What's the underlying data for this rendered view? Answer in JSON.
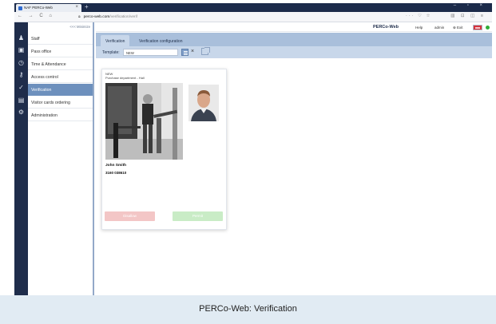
{
  "browser": {
    "tab_title": "NAF PERCo-Web",
    "tab_close": "×",
    "new_tab": "+",
    "window_controls": "– ▫ ×",
    "nav_buttons": "← → C ⌂",
    "url_host": "perco-web.com",
    "url_path": "/verification/verif",
    "url_icons": "··· ♡ ☆",
    "ext_icons": "▥ ⊡ ◫ ≡"
  },
  "sidebar_icons": [
    "person-icon",
    "box-icon",
    "clock-icon",
    "key-icon",
    "check-person-icon",
    "card-icon",
    "gear-icon"
  ],
  "menu": {
    "minimize": "<<< Minimize",
    "items": [
      {
        "label": "Staff"
      },
      {
        "label": "Pass office"
      },
      {
        "label": "Time & Attendance"
      },
      {
        "label": "Access control"
      },
      {
        "label": "Verification"
      },
      {
        "label": "Visitor cards ordering"
      },
      {
        "label": "Administration"
      }
    ],
    "active_index": 4
  },
  "topbar": {
    "brand": "PERCo-Web",
    "help": "Help",
    "user": "admin",
    "exit": "⊗ Exit"
  },
  "tabs": [
    {
      "label": "Verification",
      "active": true
    },
    {
      "label": "Verification configuration",
      "active": false
    }
  ],
  "toolbar": {
    "template_label": "Template:",
    "template_value": "NEW",
    "clear": "×"
  },
  "card": {
    "meta_line1": "NEW",
    "meta_line2": "Purchase department - Hall",
    "person_name": "John Smith",
    "card_number": "3160 038610",
    "deny_label": "Disallow",
    "allow_label": "Permit"
  },
  "caption": "PERCo-Web: Verification",
  "colors": {
    "sidebar": "#1f2d4b",
    "menu_active": "#6d90bd",
    "tabs_bar": "#a9bfdb",
    "toolbar": "#c8d7ea",
    "deny": "#f3c6c6",
    "allow": "#c9ecc6"
  }
}
